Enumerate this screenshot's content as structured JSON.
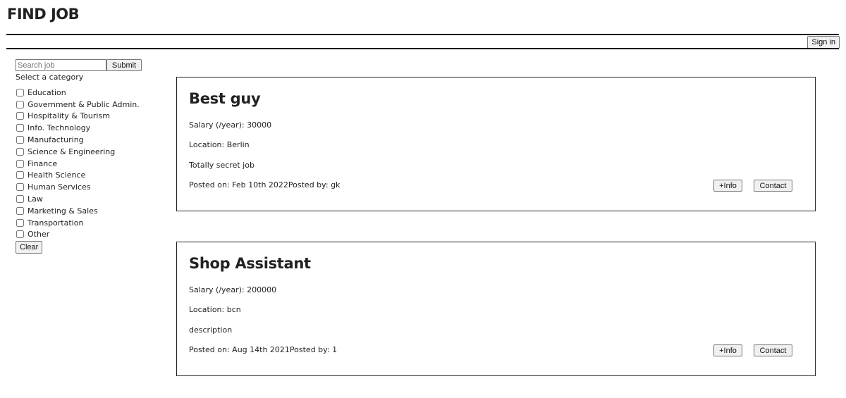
{
  "header": {
    "title": "FIND JOB",
    "signin_label": "Sign in"
  },
  "sidebar": {
    "search_placeholder": "Search job",
    "search_value": "",
    "submit_label": "Submit",
    "category_title": "Select a category",
    "categories": [
      {
        "label": "Education",
        "checked": false
      },
      {
        "label": "Government & Public Admin.",
        "checked": false
      },
      {
        "label": "Hospitality & Tourism",
        "checked": false
      },
      {
        "label": "Info. Technology",
        "checked": false
      },
      {
        "label": "Manufacturing",
        "checked": false
      },
      {
        "label": "Science & Engineering",
        "checked": false
      },
      {
        "label": "Finance",
        "checked": false
      },
      {
        "label": "Health Science",
        "checked": false
      },
      {
        "label": "Human Services",
        "checked": false
      },
      {
        "label": "Law",
        "checked": false
      },
      {
        "label": "Marketing & Sales",
        "checked": false
      },
      {
        "label": "Transportation",
        "checked": false
      },
      {
        "label": "Other",
        "checked": false
      }
    ],
    "clear_label": "Clear"
  },
  "jobs": [
    {
      "title": "Best guy",
      "salary": "Salary (/year): 30000",
      "location": "Location: Berlin",
      "description": "Totally secret job",
      "posted": "Posted on: Feb 10th 2022Posted by: gk",
      "info_label": "+Info",
      "contact_label": "Contact"
    },
    {
      "title": "Shop Assistant",
      "salary": "Salary (/year): 200000",
      "location": "Location: bcn",
      "description": "description",
      "posted": "Posted on: Aug 14th 2021Posted by: 1",
      "info_label": "+Info",
      "contact_label": "Contact"
    }
  ]
}
